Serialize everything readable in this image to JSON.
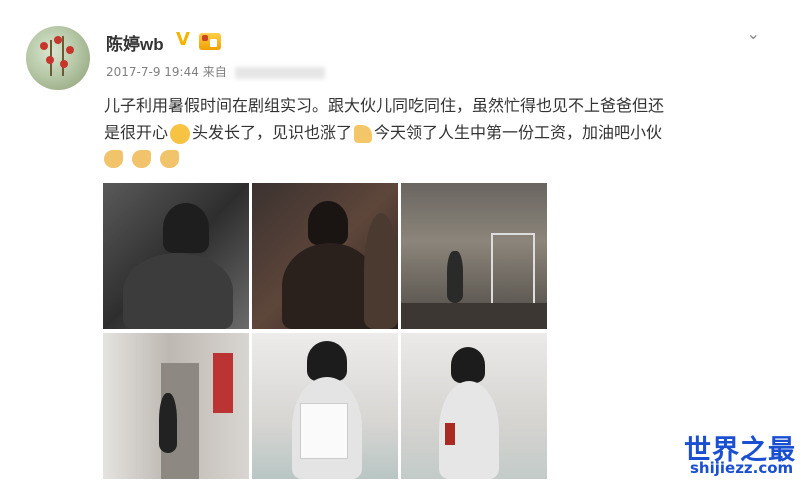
{
  "post": {
    "username": "陈婷wb",
    "verified_icon": "verified-v-icon",
    "level_icon": "member-level-icon",
    "timestamp": "2017-7-9 19:44",
    "source_prefix": "来自",
    "more_icon": "chevron-down-icon",
    "text_line1": "儿子利用暑假时间在剧组实习。跟大伙儿同吃同住，虽然忙得也见不上爸爸但还",
    "text_line2a": "是很开心",
    "text_line2b": "头发长了，见识也涨了",
    "text_line2c": "今天领了人生中第一份工资，加油吧小伙",
    "emoji_icons": [
      "laughing-face-icon",
      "thumbs-up-icon",
      "muscle-icon",
      "muscle-icon",
      "muscle-icon"
    ]
  },
  "watermark": {
    "cn": "世界之最",
    "en": "shijiezz.com"
  }
}
